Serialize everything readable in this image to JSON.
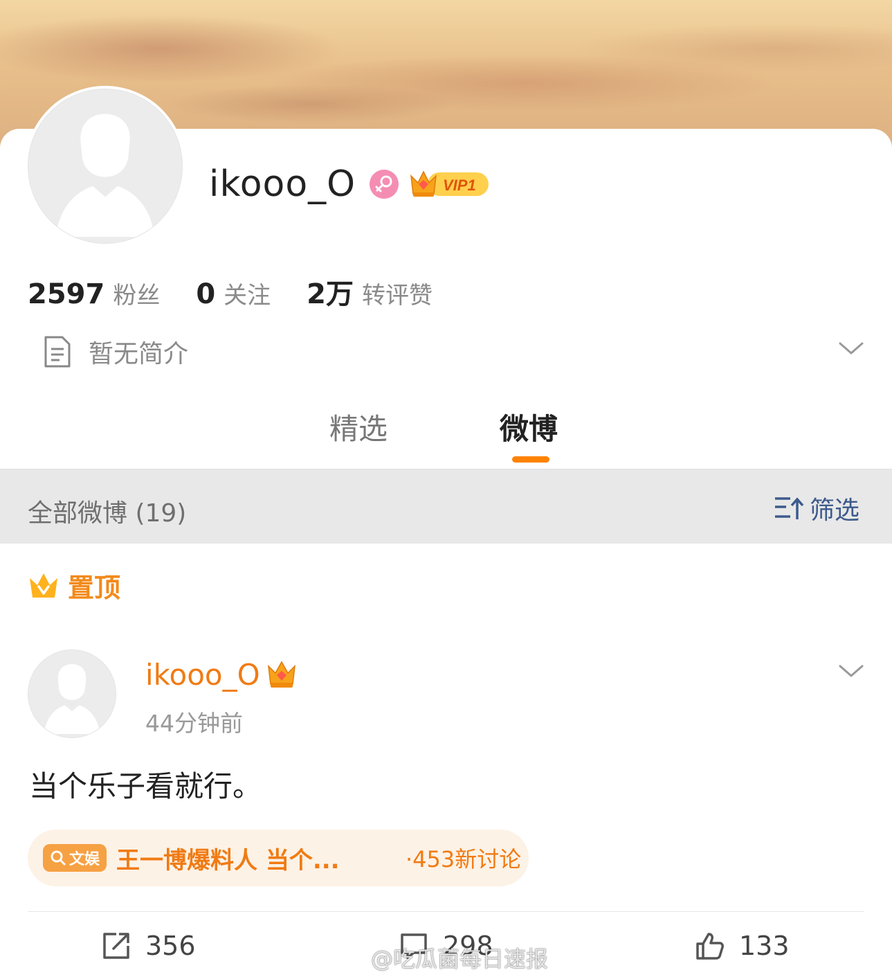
{
  "profile": {
    "username": "ikooo_O",
    "gender": "female",
    "vip_label": "VIP1",
    "stats": {
      "followers_count": "2597",
      "followers_label": "粉丝",
      "following_count": "0",
      "following_label": "关注",
      "engagement_count": "2万",
      "engagement_label": "转评赞"
    },
    "bio": "暂无简介"
  },
  "tabs": [
    {
      "label": "精选",
      "active": false
    },
    {
      "label": "微博",
      "active": true
    }
  ],
  "filter_bar": {
    "label": "全部微博 (19)",
    "filter_label": "筛选"
  },
  "pinned_label": "置顶",
  "post": {
    "author": "ikooo_O",
    "time": "44分钟前",
    "text": "当个乐子看就行。",
    "topic": {
      "tag": "文娱",
      "title": "王一博爆料人 当个...",
      "count": "·453新讨论"
    },
    "actions": {
      "repost": "356",
      "comment": "298",
      "like": "133"
    }
  },
  "watermark": "@吃瓜菌每日速报",
  "colors": {
    "accent_orange": "#ff8200",
    "name_orange": "#f07b14",
    "filter_blue": "#3d5a8c",
    "gender_pink": "#f58db3"
  },
  "icons": [
    "female-icon",
    "vip-crown-icon",
    "document-icon",
    "chevron-down-icon",
    "filter-icon",
    "pinned-crown-icon",
    "search-icon",
    "repost-icon",
    "comment-icon",
    "like-icon",
    "weibo-logo-icon"
  ]
}
